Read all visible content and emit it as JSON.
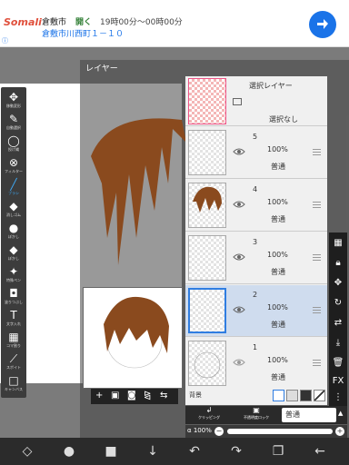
{
  "ad": {
    "brand": "Somali",
    "city": "倉敷市",
    "open": "開く",
    "hours": "19時00分～00時00分",
    "address": "倉敷市川西町１－１０"
  },
  "tools": [
    {
      "label": "移動変形",
      "icon": "move-icon"
    },
    {
      "label": "自動選択",
      "icon": "magic-wand-icon"
    },
    {
      "label": "投げ縄",
      "icon": "lasso-icon"
    },
    {
      "label": "フィルター",
      "icon": "filter-icon"
    },
    {
      "label": "ブラシ",
      "icon": "brush-icon",
      "active": true
    },
    {
      "label": "消しゴム",
      "icon": "eraser-icon"
    },
    {
      "label": "ぼかし",
      "icon": "blur-icon"
    },
    {
      "label": "ぼかし",
      "icon": "smudge-icon"
    },
    {
      "label": "特殊ペン",
      "icon": "special-pen-icon"
    },
    {
      "label": "塗りつぶし",
      "icon": "bucket-icon"
    },
    {
      "label": "文字入れ",
      "icon": "text-icon"
    },
    {
      "label": "コマ割り",
      "icon": "frame-icon"
    },
    {
      "label": "スポイト",
      "icon": "eyedropper-icon"
    },
    {
      "label": "キャンバス",
      "icon": "canvas-icon"
    }
  ],
  "dialog": {
    "title": "レイヤー"
  },
  "selection_layer": {
    "title": "選択レイヤー",
    "status": "選択なし"
  },
  "layers": [
    {
      "number": "5",
      "opacity": "100%",
      "mode": "普通"
    },
    {
      "number": "4",
      "opacity": "100%",
      "mode": "普通"
    },
    {
      "number": "3",
      "opacity": "100%",
      "mode": "普通"
    },
    {
      "number": "2",
      "opacity": "100%",
      "mode": "普通",
      "selected": true
    },
    {
      "number": "1",
      "opacity": "100%",
      "mode": "普通"
    }
  ],
  "background": {
    "label": "背景"
  },
  "blend": {
    "clipping_label": "クリッピング",
    "lock_label": "不透明度ロック",
    "mode": "普通"
  },
  "alpha": {
    "label": "α 100%",
    "value": 1.0
  },
  "colors": {
    "hair": "#8a4a1e",
    "accent": "#2f7de1",
    "brush_active": "#3fa9f5"
  }
}
